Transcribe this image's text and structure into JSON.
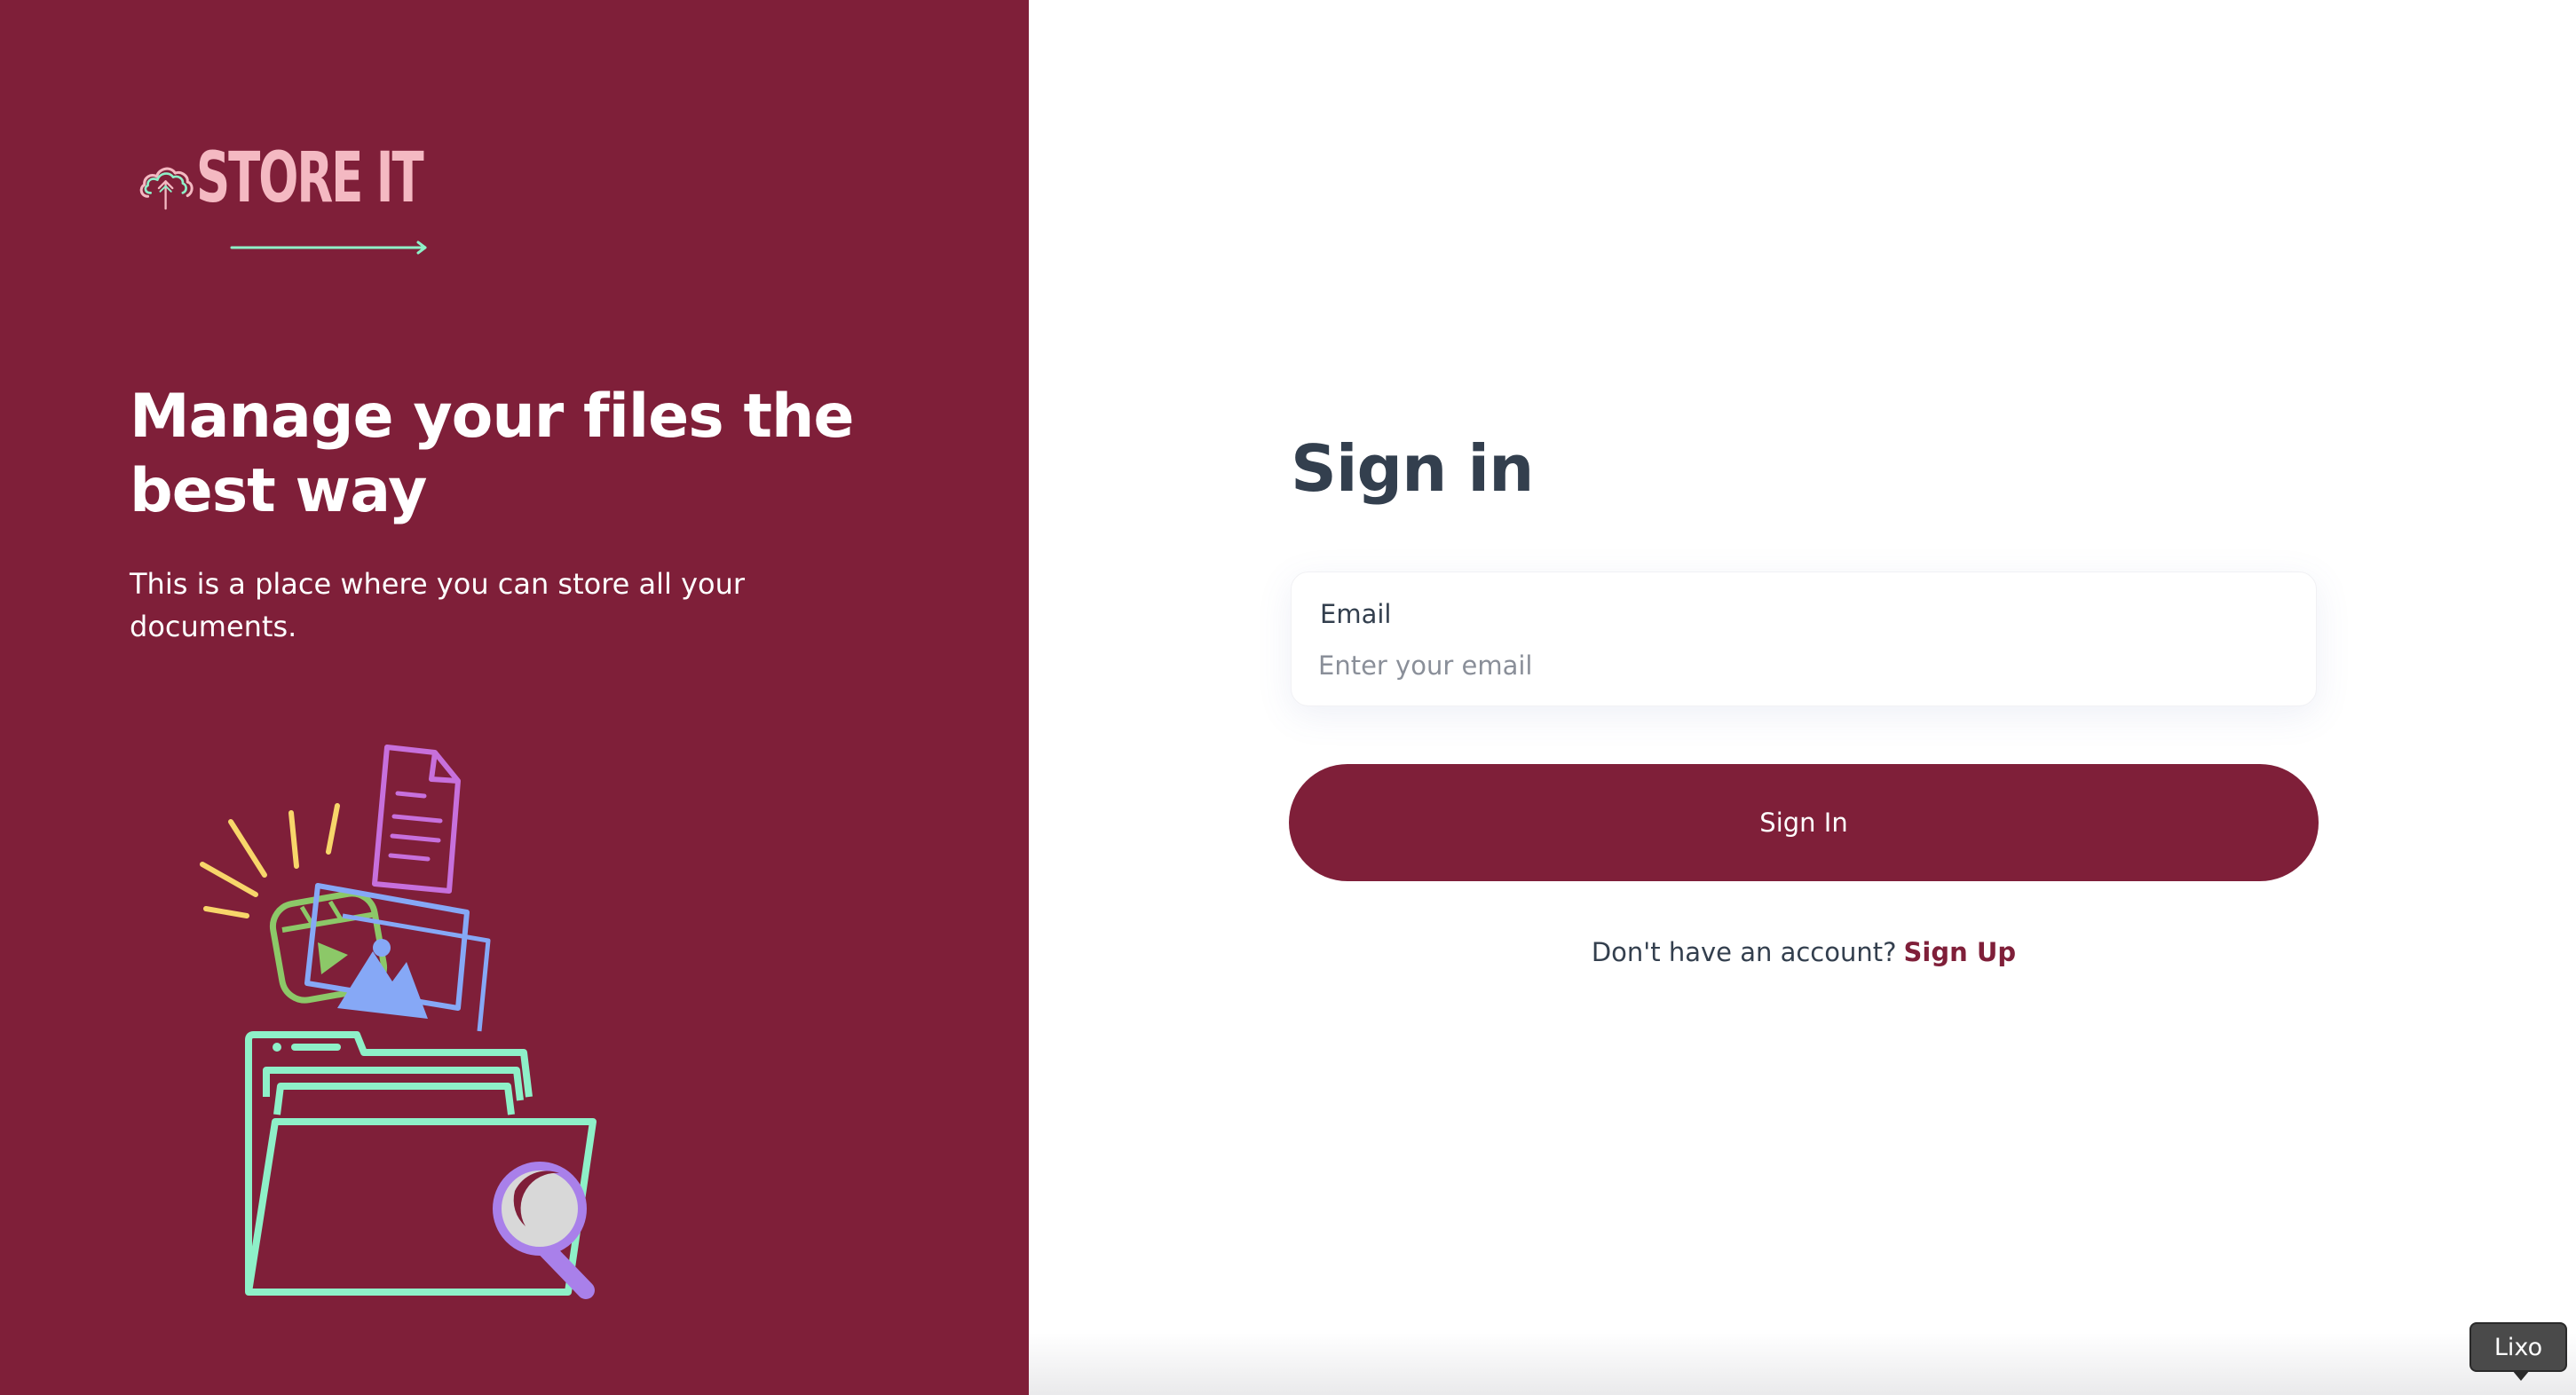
{
  "brand": {
    "name": "STORE IT",
    "colors": {
      "primary": "#7f1f39",
      "logo_text": "#f4b9c2",
      "logo_accent": "#8ef0c8",
      "heading": "#333f4e"
    }
  },
  "hero": {
    "title": "Manage your files the best way",
    "subtitle": "This is a place where you can store all your documents."
  },
  "illustration": {
    "icons": [
      "document-icon",
      "video-icon",
      "image-icon",
      "folder-icon",
      "magnifier-icon"
    ]
  },
  "signin": {
    "title": "Sign in",
    "email": {
      "label": "Email",
      "placeholder": "Enter your email",
      "value": ""
    },
    "button_label": "Sign In",
    "footer_text": "Don't have an account?",
    "signup_link": "Sign Up"
  },
  "tooltip": {
    "text": "Lixo"
  }
}
